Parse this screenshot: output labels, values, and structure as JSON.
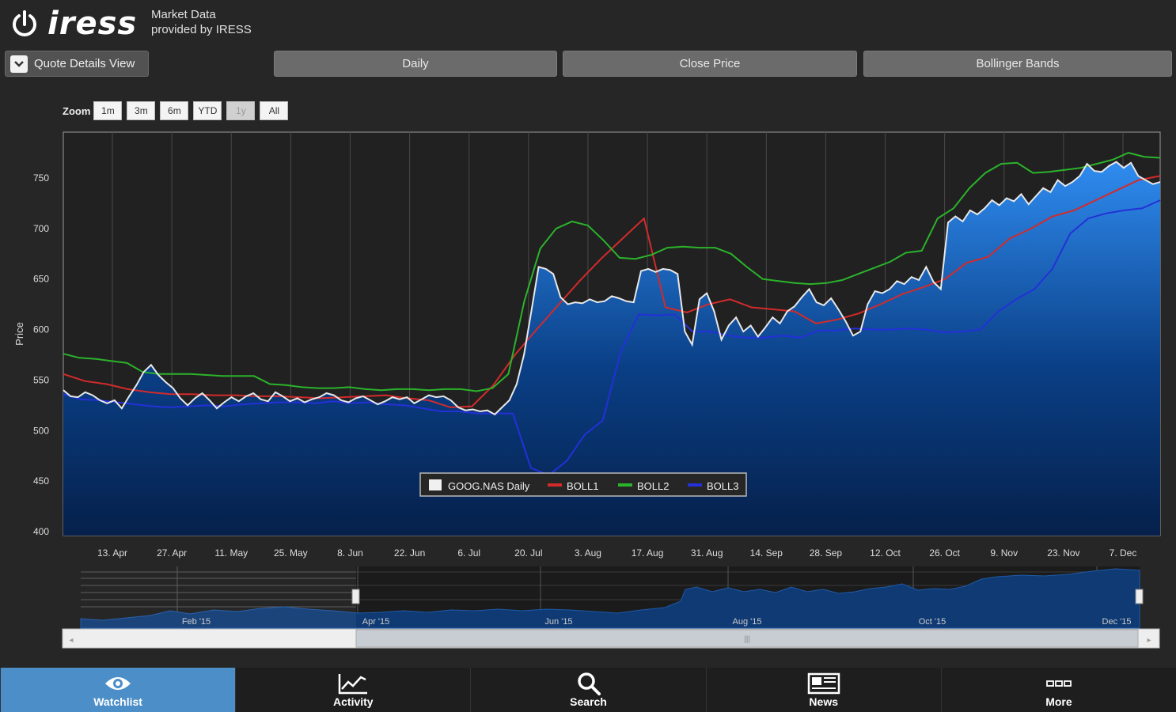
{
  "header": {
    "brand": "iress",
    "provider_line1": "Market Data",
    "provider_line2": "provided by IRESS"
  },
  "toolbar": {
    "view_label": "Quote Details View",
    "interval": "Daily",
    "price_type": "Close Price",
    "indicator": "Bollinger Bands"
  },
  "zoom": {
    "label": "Zoom",
    "options": [
      "1m",
      "3m",
      "6m",
      "YTD",
      "1y",
      "All"
    ],
    "selected": "1y"
  },
  "chart_data": {
    "type": "area",
    "ylabel": "Price",
    "ylim": [
      400,
      800
    ],
    "yticks": [
      400,
      450,
      500,
      550,
      600,
      650,
      700,
      750
    ],
    "xticks": [
      "13. Apr",
      "27. Apr",
      "11. May",
      "25. May",
      "8. Jun",
      "22. Jun",
      "6. Jul",
      "20. Jul",
      "3. Aug",
      "17. Aug",
      "31. Aug",
      "14. Sep",
      "28. Sep",
      "12. Oct",
      "26. Oct",
      "9. Nov",
      "23. Nov",
      "7. Dec"
    ],
    "grid": true,
    "legend_position": "bottom-center",
    "series": [
      {
        "name": "GOOG.NAS Daily",
        "color": "#e8e8e8",
        "values": [
          540,
          534,
          533,
          538,
          535,
          530,
          527,
          530,
          522,
          534,
          545,
          558,
          565,
          555,
          548,
          542,
          532,
          525,
          532,
          537,
          530,
          522,
          528,
          533,
          529,
          534,
          537,
          531,
          529,
          538,
          534,
          529,
          532,
          528,
          531,
          533,
          537,
          535,
          530,
          528,
          532,
          534,
          530,
          526,
          529,
          533,
          531,
          533,
          527,
          531,
          535,
          533,
          534,
          530,
          523,
          520,
          521,
          519,
          520,
          516,
          523,
          530,
          546,
          575,
          618,
          662,
          660,
          655,
          632,
          625,
          627,
          626,
          630,
          627,
          628,
          633,
          631,
          628,
          627,
          658,
          660,
          657,
          660,
          659,
          655,
          598,
          585,
          630,
          636,
          618,
          590,
          604,
          612,
          598,
          604,
          593,
          602,
          612,
          606,
          618,
          623,
          632,
          640,
          627,
          624,
          631,
          620,
          608,
          594,
          598,
          625,
          638,
          636,
          640,
          648,
          645,
          652,
          649,
          662,
          647,
          640,
          706,
          712,
          707,
          718,
          714,
          720,
          728,
          723,
          730,
          727,
          734,
          724,
          732,
          740,
          736,
          748,
          742,
          746,
          752,
          764,
          757,
          756,
          762,
          766,
          760,
          765,
          752,
          748,
          744,
          746
        ]
      },
      {
        "name": "BOLL1",
        "color": "#d22b2b",
        "values": [
          556,
          549,
          546,
          541,
          538,
          536,
          536,
          535,
          535,
          534,
          534,
          533,
          532,
          533,
          534,
          535,
          532,
          530,
          523,
          524,
          545,
          575,
          600,
          624,
          648,
          670,
          690,
          710,
          622,
          617,
          625,
          630,
          622,
          620,
          618,
          606,
          610,
          616,
          625,
          635,
          642,
          650,
          666,
          672,
          690,
          700,
          712,
          718,
          728,
          738,
          748,
          752
        ]
      },
      {
        "name": "BOLL2",
        "color": "#2bb32b",
        "values": [
          576,
          572,
          571,
          569,
          567,
          558,
          556,
          556,
          556,
          555,
          554,
          554,
          554,
          546,
          545,
          543,
          542,
          542,
          543,
          541,
          540,
          541,
          541,
          540,
          541,
          541,
          539,
          542,
          556,
          628,
          680,
          700,
          707,
          703,
          688,
          671,
          670,
          674,
          681,
          682,
          681,
          681,
          675,
          662,
          650,
          648,
          646,
          645,
          646,
          649,
          655,
          661,
          667,
          676,
          678,
          710,
          720,
          740,
          755,
          764,
          765,
          755,
          756,
          758,
          760,
          764,
          768,
          775,
          771,
          770
        ]
      },
      {
        "name": "BOLL3",
        "color": "#2430d8",
        "values": [
          536,
          531,
          530,
          528,
          526,
          524,
          523,
          524,
          525,
          524,
          526,
          527,
          528,
          528,
          527,
          529,
          527,
          528,
          526,
          525,
          522,
          519,
          519,
          517,
          517,
          517,
          463,
          456,
          470,
          496,
          510,
          578,
          615,
          614,
          615,
          598,
          598,
          594,
          592,
          592,
          594,
          592,
          599,
          599,
          601,
          600,
          600,
          601,
          600,
          597,
          598,
          600,
          618,
          630,
          640,
          660,
          695,
          710,
          715,
          718,
          720,
          728
        ]
      }
    ]
  },
  "navigator": {
    "labels": [
      "Feb '15",
      "Apr '15",
      "Jun '15",
      "Aug '15",
      "Oct '15",
      "Dec '15"
    ],
    "range": [
      0.25,
      1.0
    ]
  },
  "tabs": [
    {
      "label": "Watchlist",
      "icon": "eye-icon",
      "active": true
    },
    {
      "label": "Activity",
      "icon": "chart-line-icon",
      "active": false
    },
    {
      "label": "Search",
      "icon": "search-icon",
      "active": false
    },
    {
      "label": "News",
      "icon": "newspaper-icon",
      "active": false
    },
    {
      "label": "More",
      "icon": "more-dots-icon",
      "active": false
    }
  ]
}
